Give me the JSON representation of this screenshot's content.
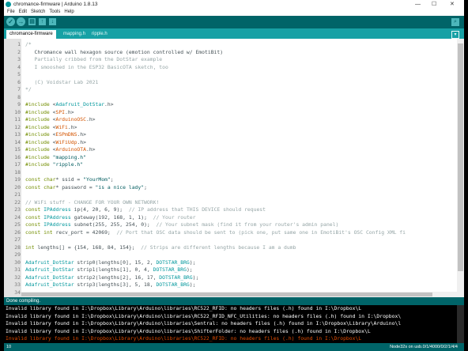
{
  "window": {
    "title": "chromance-firmware | Arduino 1.8.13",
    "minimize": "—",
    "maximize": "☐",
    "close": "✕"
  },
  "menu": [
    "File",
    "Edit",
    "Sketch",
    "Tools",
    "Help"
  ],
  "toolbar": {
    "verify": "✓",
    "upload": "→",
    "new": "▤",
    "open": "↑",
    "save": "↓",
    "serial_monitor": "⌕"
  },
  "tabs": [
    "chromance-firmware",
    "mapping.h",
    "ripple.h"
  ],
  "tab_menu": "▾",
  "code_lines": [
    {
      "n": "1",
      "t": "/*"
    },
    {
      "n": "2",
      "t": "   Chromance wall hexagon source (emotion controlled w/ EmotiBit)"
    },
    {
      "n": "3",
      "t": "   Partially cribbed from the DotStar example"
    },
    {
      "n": "4",
      "t": "   I smooshed in the ESP32 BasicOTA sketch, too"
    },
    {
      "n": "5",
      "t": ""
    },
    {
      "n": "6",
      "t": "   (C) Voidstar Lab 2021"
    },
    {
      "n": "7",
      "t": "*/"
    },
    {
      "n": "8",
      "t": ""
    },
    {
      "n": "9",
      "t": "#include <Adafruit_DotStar.h>"
    },
    {
      "n": "10",
      "t": "#include <SPI.h>"
    },
    {
      "n": "11",
      "t": "#include <ArduinoOSC.h>"
    },
    {
      "n": "12",
      "t": "#include <WiFi.h>"
    },
    {
      "n": "13",
      "t": "#include <ESPmDNS.h>"
    },
    {
      "n": "14",
      "t": "#include <WiFiUdp.h>"
    },
    {
      "n": "15",
      "t": "#include <ArduinoOTA.h>"
    },
    {
      "n": "16",
      "t": "#include \"mapping.h\""
    },
    {
      "n": "17",
      "t": "#include \"ripple.h\""
    },
    {
      "n": "18",
      "t": ""
    },
    {
      "n": "19",
      "t": "const char* ssid = \"YourMom\";"
    },
    {
      "n": "20",
      "t": "const char* password = \"is a nice lady\";"
    },
    {
      "n": "21",
      "t": ""
    },
    {
      "n": "22",
      "t": "// WiFi stuff - CHANGE FOR YOUR OWN NETWORK!"
    },
    {
      "n": "23",
      "t": "const IPAddress ip(4, 20, 6, 9);  // IP address that THIS DEVICE should request"
    },
    {
      "n": "24",
      "t": "const IPAddress gateway(192, 168, 1, 1);  // Your router"
    },
    {
      "n": "25",
      "t": "const IPAddress subnet(255, 255, 254, 0);  // Your subnet mask (find it from your router's admin panel)"
    },
    {
      "n": "26",
      "t": "const int recv_port = 42069;  // Port that OSC data should be sent to (pick one, put same one in EmotiBit's OSC Config XML fi"
    },
    {
      "n": "27",
      "t": ""
    },
    {
      "n": "28",
      "t": "int lengths[] = {154, 168, 84, 154};  // Strips are different lengths because I am a dumb"
    },
    {
      "n": "29",
      "t": ""
    },
    {
      "n": "30",
      "t": "Adafruit_DotStar strip0(lengths[0], 15, 2, DOTSTAR_BRG);"
    },
    {
      "n": "31",
      "t": "Adafruit_DotStar strip1(lengths[1], 0, 4, DOTSTAR_BRG);"
    },
    {
      "n": "32",
      "t": "Adafruit_DotStar strip2(lengths[2], 16, 17, DOTSTAR_BRG);"
    },
    {
      "n": "33",
      "t": "Adafruit_DotStar strip3(lengths[3], 5, 18, DOTSTAR_BRG);"
    },
    {
      "n": "34",
      "t": ""
    }
  ],
  "status": "Done compiling.",
  "console_lines": [
    {
      "t": "Invalid library found in I:\\Dropbox\\Library\\Arduino\\libraries\\RC522_RFID: no headers files (.h) found in I:\\Dropbox\\L",
      "red": false
    },
    {
      "t": "Invalid library found in I:\\Dropbox\\Library\\Arduino\\libraries\\RC522_RFID_NFC_Utilities: no headers files (.h) found in I:\\Dropbox\\",
      "red": false
    },
    {
      "t": "Invalid library found in I:\\Dropbox\\Library\\Arduino\\libraries\\Sentral: no headers files (.h) found in I:\\Dropbox\\Library\\Arduino\\l",
      "red": false
    },
    {
      "t": "Invalid library found in I:\\Dropbox\\Library\\Arduino\\libraries\\ShifterFolder: no headers files (.h) found in I:\\Dropbox\\L",
      "red": false
    },
    {
      "t": "Invalid library found in I:\\Dropbox\\Library\\Arduino\\libraries\\RC522_RFID: no headers files (.h) found in I:\\Dropbox\\L",
      "red": true
    }
  ],
  "bottom": {
    "line": "10",
    "board": "Node32s on usb.0/1/4000/0/2/1/4/4"
  }
}
